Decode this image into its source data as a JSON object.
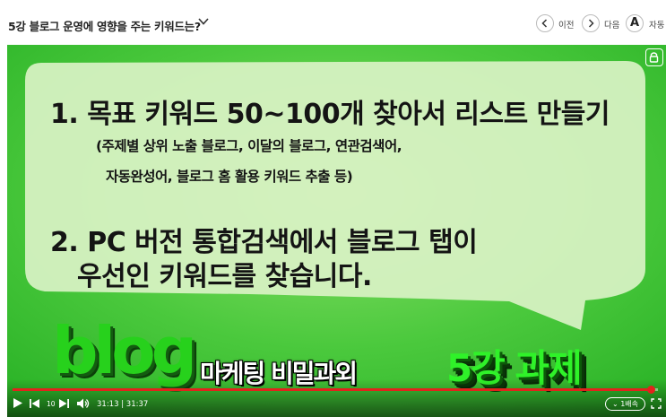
{
  "header": {
    "title": "5강 블로그 운영에 영향을 주는 키워드는?",
    "prev_label": "이전",
    "next_label": "다음",
    "font_button": "A",
    "auto_label": "자동"
  },
  "slide": {
    "line1": "1. 목표 키워드 50~100개 찾아서 리스트 만들기",
    "line2": "(주제별 상위 노출 블로그, 이달의 블로그, 연관검색어,",
    "line3": "자동완성어, 블로그 홈 활용 키워드 추출 등)",
    "line4": "2. PC 버전 통합검색에서 블로그 탭이",
    "line5": "우선인 키워드를 찾습니다.",
    "brand": "blog",
    "tagline": "마케팅 비밀과외",
    "lesson": "5강 과제"
  },
  "player": {
    "progress_fraction": 0.989,
    "skip_seconds": "10",
    "current_time": "31:13",
    "total_time": "31:37",
    "speed": "1배속"
  },
  "colors": {
    "video_green": "#39c236",
    "bubble": "#d9f3c6",
    "progress": "#e1231c"
  }
}
